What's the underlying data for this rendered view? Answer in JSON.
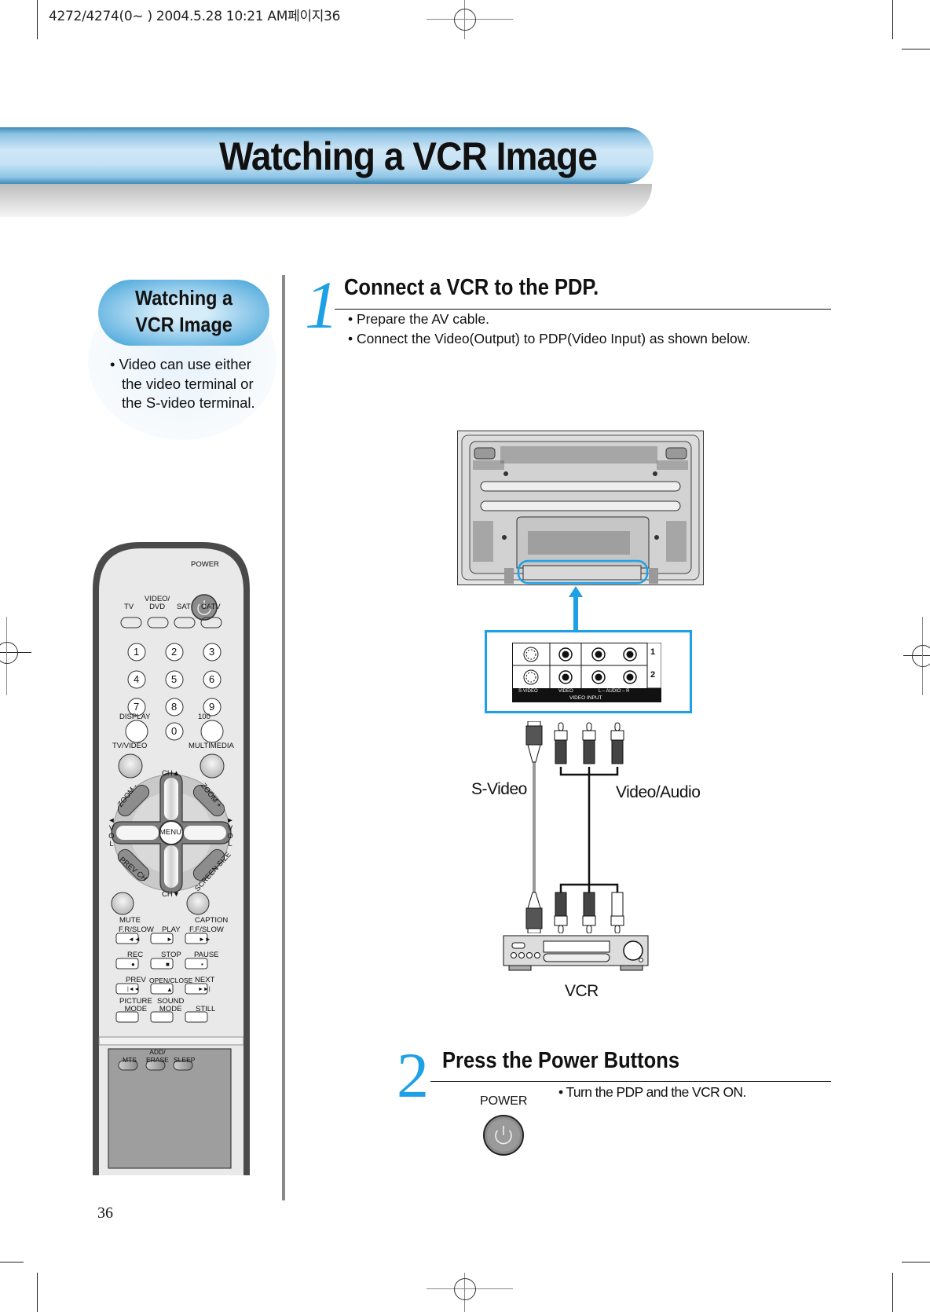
{
  "print_header": "4272/4274(0~ ) 2004.5.28 10:21 AM페이지36",
  "banner": {
    "title": "Watching a VCR Image"
  },
  "sidebar": {
    "pill_title_line1": "Watching a",
    "pill_title_line2": "VCR Image",
    "note_lines": [
      "• Video can use either",
      "the video terminal or",
      "the S-video terminal."
    ]
  },
  "step1": {
    "number": "1",
    "title": "Connect a VCR to the PDP.",
    "bullets": [
      "• Prepare the AV cable.",
      "• Connect the Video(Output) to PDP(Video Input) as shown below."
    ]
  },
  "diagram": {
    "panel_jacks": {
      "rows": [
        "1",
        "2"
      ],
      "column_labels": [
        "S-VIDEO",
        "VIDEO",
        "L – AUDIO – R"
      ],
      "footer_label": "VIDEO INPUT"
    },
    "label_svideo": "S-Video",
    "label_video_audio": "Video/Audio",
    "label_vcr": "VCR",
    "accent_color": "#1ea0e6"
  },
  "step2": {
    "number": "2",
    "title": "Press the Power Buttons",
    "bullet": "• Turn the PDP and the VCR ON.",
    "power_label": "POWER"
  },
  "remote": {
    "power": "POWER",
    "source_buttons": [
      "TV",
      "VIDEO/\nDVD",
      "SAT",
      "CATV"
    ],
    "digits": [
      "1",
      "2",
      "3",
      "4",
      "5",
      "6",
      "7",
      "8",
      "9",
      "0"
    ],
    "display": "DISPLAY",
    "hundred": "100",
    "tv_video": "TV/VIDEO",
    "multimedia": "MULTIMEDIA",
    "ch_up": "CH▲",
    "ch_down": "CH▼",
    "zoom_minus": "ZOOM -",
    "zoom_plus": "ZOOM +",
    "vol_left": "◄ V O L",
    "vol_right": "► V O L",
    "menu": "MENU",
    "prev_ch": "PREV CH",
    "screen_size": "SCREEN SIZE",
    "mute": "MUTE",
    "caption": "CAPTION",
    "transport": [
      {
        "label": "F.R/SLOW",
        "glyph": "◄◄"
      },
      {
        "label": "PLAY",
        "glyph": "►"
      },
      {
        "label": "F.F/SLOW",
        "glyph": "►►"
      },
      {
        "label": "REC",
        "glyph": "●"
      },
      {
        "label": "STOP",
        "glyph": "■"
      },
      {
        "label": "PAUSE",
        "glyph": "▪"
      },
      {
        "label": "PREV",
        "glyph": "|◄◄"
      },
      {
        "label": "OPEN/CLOSE",
        "glyph": "▲"
      },
      {
        "label": "NEXT",
        "glyph": "►►|"
      }
    ],
    "mode_buttons": [
      "PICTURE\nMODE",
      "SOUND\nMODE",
      "STILL"
    ],
    "lower_buttons": [
      "MTS",
      "ADD/\nERASE",
      "SLEEP"
    ]
  },
  "page_number": "36"
}
